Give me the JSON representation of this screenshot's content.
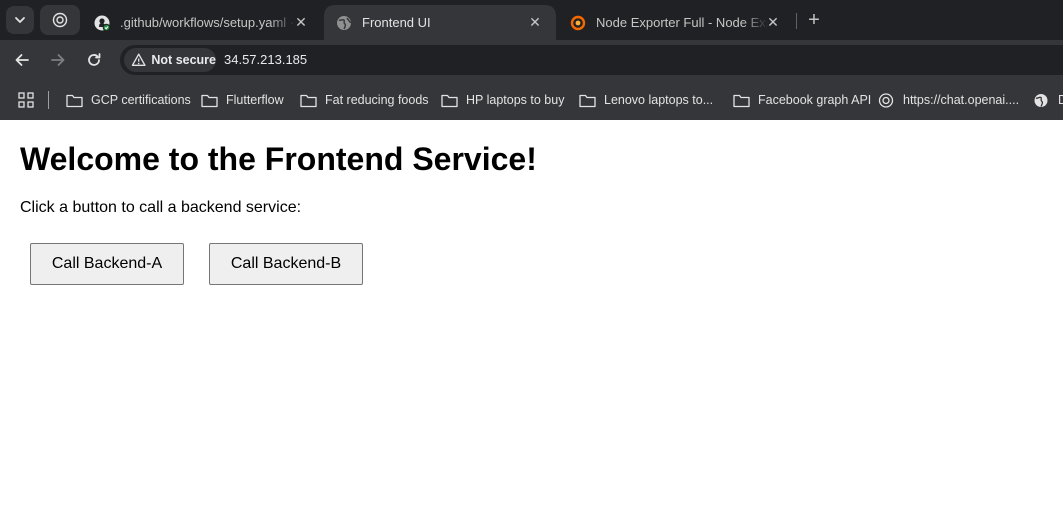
{
  "browser": {
    "tabs": [
      {
        "title": ".github/workflows/setup.yaml · ",
        "icon": "github-icon",
        "active": false
      },
      {
        "title": "Frontend UI",
        "icon": "globe-icon",
        "active": true
      },
      {
        "title": "Node Exporter Full - Node Exporter",
        "icon": "grafana-icon",
        "active": false
      }
    ],
    "close_glyph": "✕",
    "new_tab_glyph": "+",
    "security_label": "Not secure",
    "url": "34.57.213.185",
    "bookmarks": [
      {
        "label": "GCP certifications",
        "icon": "folder-icon"
      },
      {
        "label": "Flutterflow",
        "icon": "folder-icon"
      },
      {
        "label": "Fat reducing foods",
        "icon": "folder-icon"
      },
      {
        "label": "HP laptops to buy",
        "icon": "folder-icon"
      },
      {
        "label": "Lenovo laptops to...",
        "icon": "folder-icon"
      },
      {
        "label": "Facebook graph API",
        "icon": "folder-icon"
      },
      {
        "label": "https://chat.openai....",
        "icon": "openai-icon"
      },
      {
        "label": "D",
        "icon": "globe-icon"
      }
    ]
  },
  "page": {
    "heading": "Welcome to the Frontend Service!",
    "description": "Click a button to call a backend service:",
    "buttons": [
      {
        "label": "Call Backend-A"
      },
      {
        "label": "Call Backend-B"
      }
    ]
  },
  "colors": {
    "tab_strip": "#202124",
    "toolbar": "#35363a",
    "page_background": "#ffffff",
    "button_background": "#efefef"
  }
}
